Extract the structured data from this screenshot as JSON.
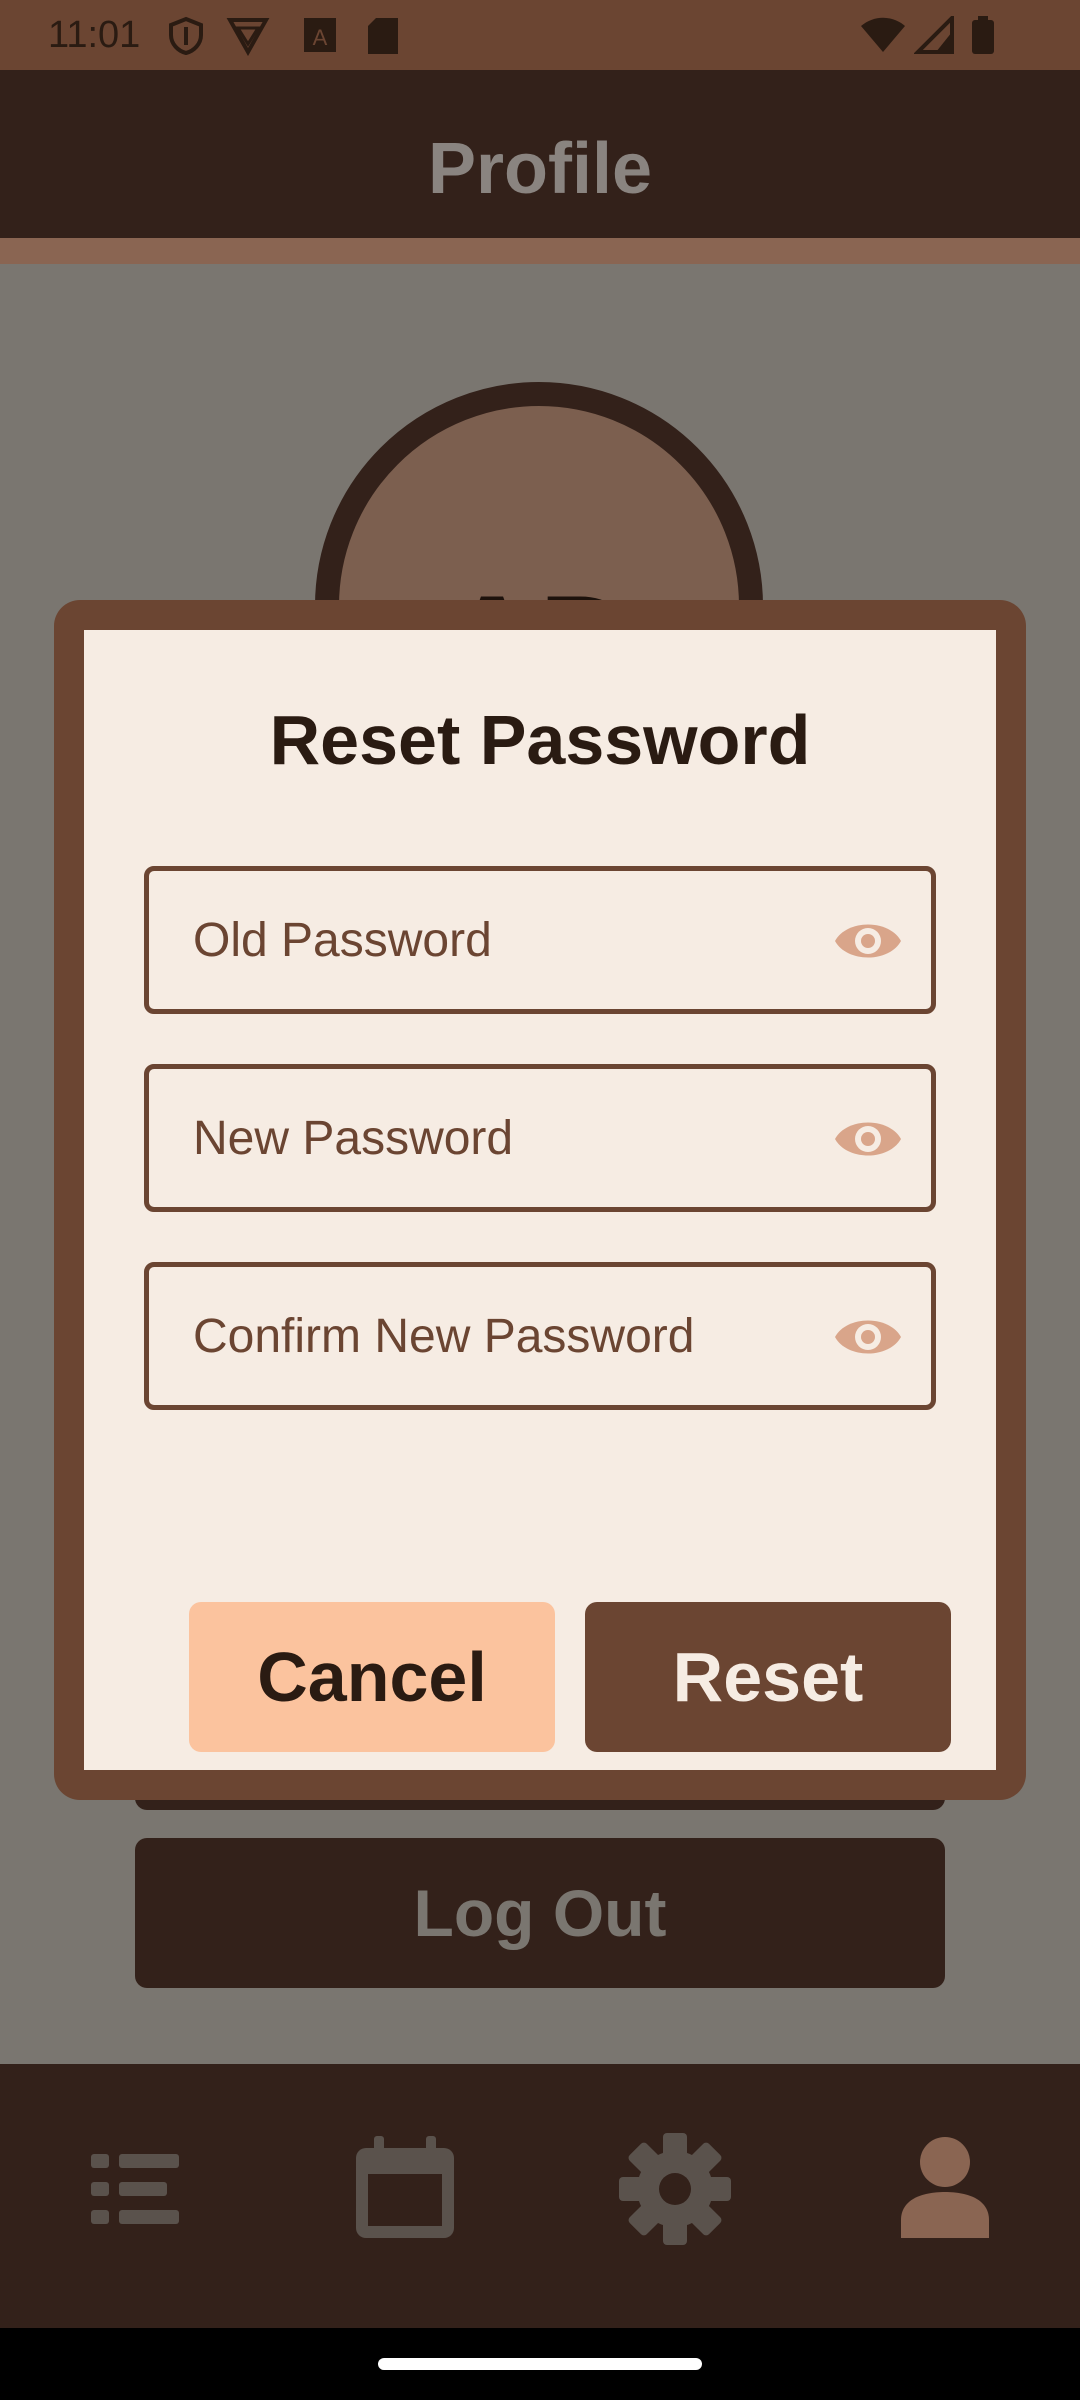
{
  "status_bar": {
    "time": "11:01"
  },
  "app_bar": {
    "title": "Profile"
  },
  "profile": {
    "initials": "AD",
    "logout_label": "Log Out"
  },
  "dialog": {
    "title": "Reset Password",
    "fields": [
      {
        "placeholder": "Old Password",
        "value": ""
      },
      {
        "placeholder": "New Password",
        "value": ""
      },
      {
        "placeholder": "Confirm New Password",
        "value": ""
      }
    ],
    "cancel_label": "Cancel",
    "reset_label": "Reset"
  },
  "bottom_nav": {
    "items": [
      {
        "icon": "list-icon",
        "active": false
      },
      {
        "icon": "calendar-icon",
        "active": false
      },
      {
        "icon": "gear-icon",
        "active": false
      },
      {
        "icon": "person-icon",
        "active": true
      }
    ]
  },
  "colors": {
    "primary": "#6b4532",
    "dark": "#33211a",
    "surface": "#f6ece3",
    "accent": "#fbc39e",
    "nav_active": "#8a6552",
    "nav_inactive": "#5a524c"
  }
}
